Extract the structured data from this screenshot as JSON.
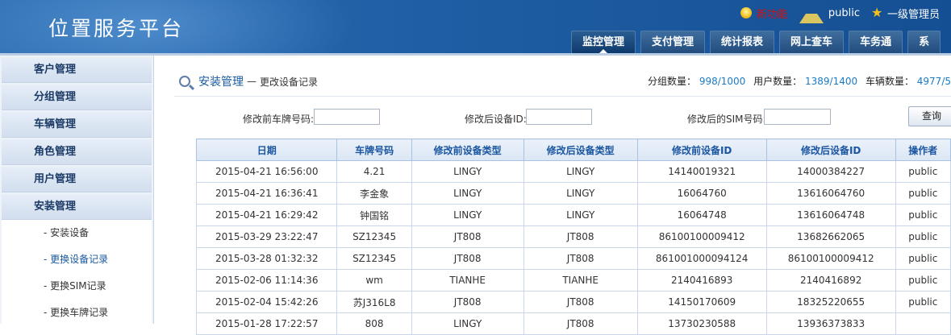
{
  "header": {
    "app_title": "位置服务平台",
    "new_feature": "新功能",
    "username": "public",
    "role": "一级管理员",
    "tabs": [
      {
        "label": "监控管理"
      },
      {
        "label": "支付管理"
      },
      {
        "label": "统计报表"
      },
      {
        "label": "网上查车"
      },
      {
        "label": "车务通"
      },
      {
        "label": "系"
      }
    ],
    "active_tab": "监控管理"
  },
  "sidebar": {
    "items": [
      {
        "label": "客户管理"
      },
      {
        "label": "分组管理"
      },
      {
        "label": "车辆管理"
      },
      {
        "label": "角色管理"
      },
      {
        "label": "用户管理"
      },
      {
        "label": "安装管理"
      }
    ],
    "subitems": [
      {
        "label": "- 安装设备"
      },
      {
        "label": "- 更换设备记录"
      },
      {
        "label": "- 更换SIM记录"
      },
      {
        "label": "- 更换车牌记录"
      }
    ],
    "active_subitem": "- 更换设备记录"
  },
  "breadcrumb": {
    "section": "安装管理",
    "separator": "—",
    "page": "更改设备记录"
  },
  "stats": {
    "group_label": "分组数量：",
    "group_value": "998/1000",
    "user_label": "用户数量：",
    "user_value": "1389/1400",
    "vehicle_label": "车辆数量：",
    "vehicle_value": "4977/5"
  },
  "search": {
    "plate_before_label": "修改前车牌号码:",
    "plate_before_value": "",
    "device_after_label": "修改后设备ID:",
    "device_after_value": "",
    "sim_after_label": "修改后的SIM号码:",
    "sim_after_value": "",
    "query_button": "查询"
  },
  "table": {
    "columns": [
      "日期",
      "车牌号码",
      "修改前设备类型",
      "修改后设备类型",
      "修改前设备ID",
      "修改后设备ID",
      "操作者"
    ],
    "rows": [
      [
        "2015-04-21 16:56:00",
        "4.21",
        "LINGY",
        "LINGY",
        "14140019321",
        "14000384227",
        "public"
      ],
      [
        "2015-04-21 16:36:41",
        "李金象",
        "LINGY",
        "LINGY",
        "16064760",
        "13616064760",
        "public"
      ],
      [
        "2015-04-21 16:29:42",
        "钟国铭",
        "LINGY",
        "LINGY",
        "16064748",
        "13616064748",
        "public"
      ],
      [
        "2015-03-29 23:22:47",
        "SZ12345",
        "JT808",
        "JT808",
        "86100100009412",
        "13682662065",
        "public"
      ],
      [
        "2015-03-28 01:32:32",
        "SZ12345",
        "JT808",
        "JT808",
        "861001000094124",
        "86100100009412",
        "public"
      ],
      [
        "2015-02-06 11:14:36",
        "wm",
        "TIANHE",
        "TIANHE",
        "2140416893",
        "2140416892",
        "public"
      ],
      [
        "2015-02-04 15:42:26",
        "苏J316L8",
        "JT808",
        "JT808",
        "14150170609",
        "18325220655",
        "public"
      ],
      [
        "2015-01-28 17:22:57",
        "808",
        "LINGY",
        "JT808",
        "13730230588",
        "13936373833",
        ""
      ]
    ]
  }
}
